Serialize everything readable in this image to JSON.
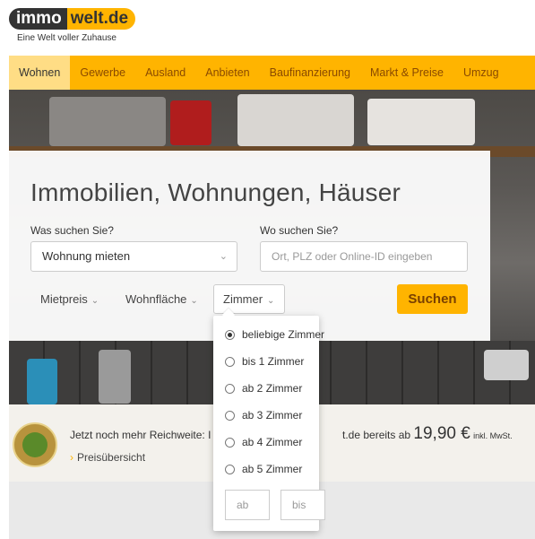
{
  "brand": {
    "logo_left": "immo",
    "logo_right": "welt.de",
    "tagline": "Eine Welt voller Zuhause"
  },
  "nav": {
    "items": [
      {
        "label": "Wohnen",
        "active": true
      },
      {
        "label": "Gewerbe",
        "active": false
      },
      {
        "label": "Ausland",
        "active": false
      },
      {
        "label": "Anbieten",
        "active": false
      },
      {
        "label": "Baufinanzierung",
        "active": false
      },
      {
        "label": "Markt & Preise",
        "active": false
      },
      {
        "label": "Umzug",
        "active": false
      }
    ]
  },
  "search": {
    "title": "Immobilien, Wohnungen, Häuser",
    "what_label": "Was suchen Sie?",
    "what_value": "Wohnung mieten",
    "where_label": "Wo suchen Sie?",
    "where_placeholder": "Ort, PLZ oder Online-ID eingeben",
    "filter_price": "Mietpreis",
    "filter_area": "Wohnfläche",
    "filter_rooms": "Zimmer",
    "search_button": "Suchen"
  },
  "rooms_dropdown": {
    "options": [
      "beliebige Zimmer",
      "bis 1 Zimmer",
      "ab 2 Zimmer",
      "ab 3 Zimmer",
      "ab 4 Zimmer",
      "ab 5 Zimmer"
    ],
    "selected": "beliebige Zimmer",
    "from_placeholder": "ab",
    "to_placeholder": "bis"
  },
  "promo": {
    "text_left": "Jetzt noch mehr Reichweite: I",
    "text_right": "t.de bereits ab",
    "price": "19,90 €",
    "price_note": "inkl. MwSt.",
    "link": "Preisübersicht"
  },
  "colors": {
    "accent": "#ffb400",
    "nav_active": "#ffdd85",
    "dark": "#333333"
  },
  "icons": [
    "chevron-down-icon",
    "radio-icon",
    "arrow-right-icon",
    "award-seal-icon"
  ]
}
